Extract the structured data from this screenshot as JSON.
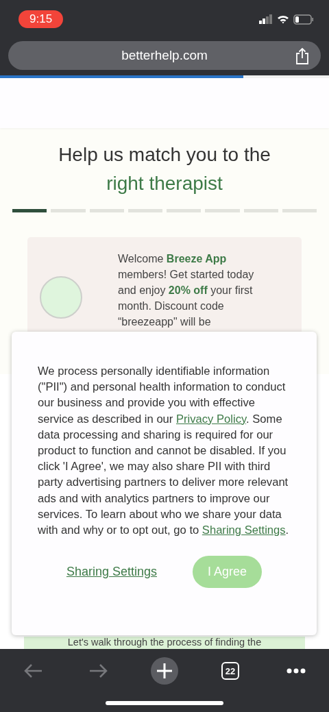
{
  "status_bar": {
    "time": "9:15"
  },
  "address_bar": {
    "domain": "betterhelp.com"
  },
  "page_load": {
    "level": 0.74
  },
  "heading": "Help us match you to the **right therapist**",
  "steps": [
    {
      "selected": true
    },
    {
      "selected": false
    },
    {
      "selected": false
    },
    {
      "selected": false
    },
    {
      "selected": false
    },
    {
      "selected": false
    },
    {
      "selected": false
    },
    {
      "selected": false
    }
  ],
  "promo": {
    "text": "Welcome **Breeze App** members! Get started today and enjoy **20% off** your first month. Discount code “breezeapp\" will be"
  },
  "consent": {
    "segments": [
      {
        "kind": "text",
        "text": "We process personally identifiable information (\"PII\") and personal health information to conduct our business and provide you with effective service as described in our "
      },
      {
        "kind": "link",
        "text": "Privacy Policy"
      },
      {
        "kind": "text",
        "text": ". Some data processing and sharing is required for our product to function and cannot be disabled. If you click 'I Agree', we may also share PII with third party advertising partners to deliver more relevant ads and with analytics partners to improve our services. To learn about who we share your data with and why or to opt out, go to "
      },
      {
        "kind": "link",
        "text": "Sharing Settings"
      },
      {
        "kind": "text",
        "text": "."
      }
    ],
    "settings_link": "Sharing Settings",
    "agree_button": "I Agree"
  },
  "intro_band": {
    "text": "Let's walk through the process of finding the"
  },
  "toolbar": {
    "tab_count": "22"
  }
}
